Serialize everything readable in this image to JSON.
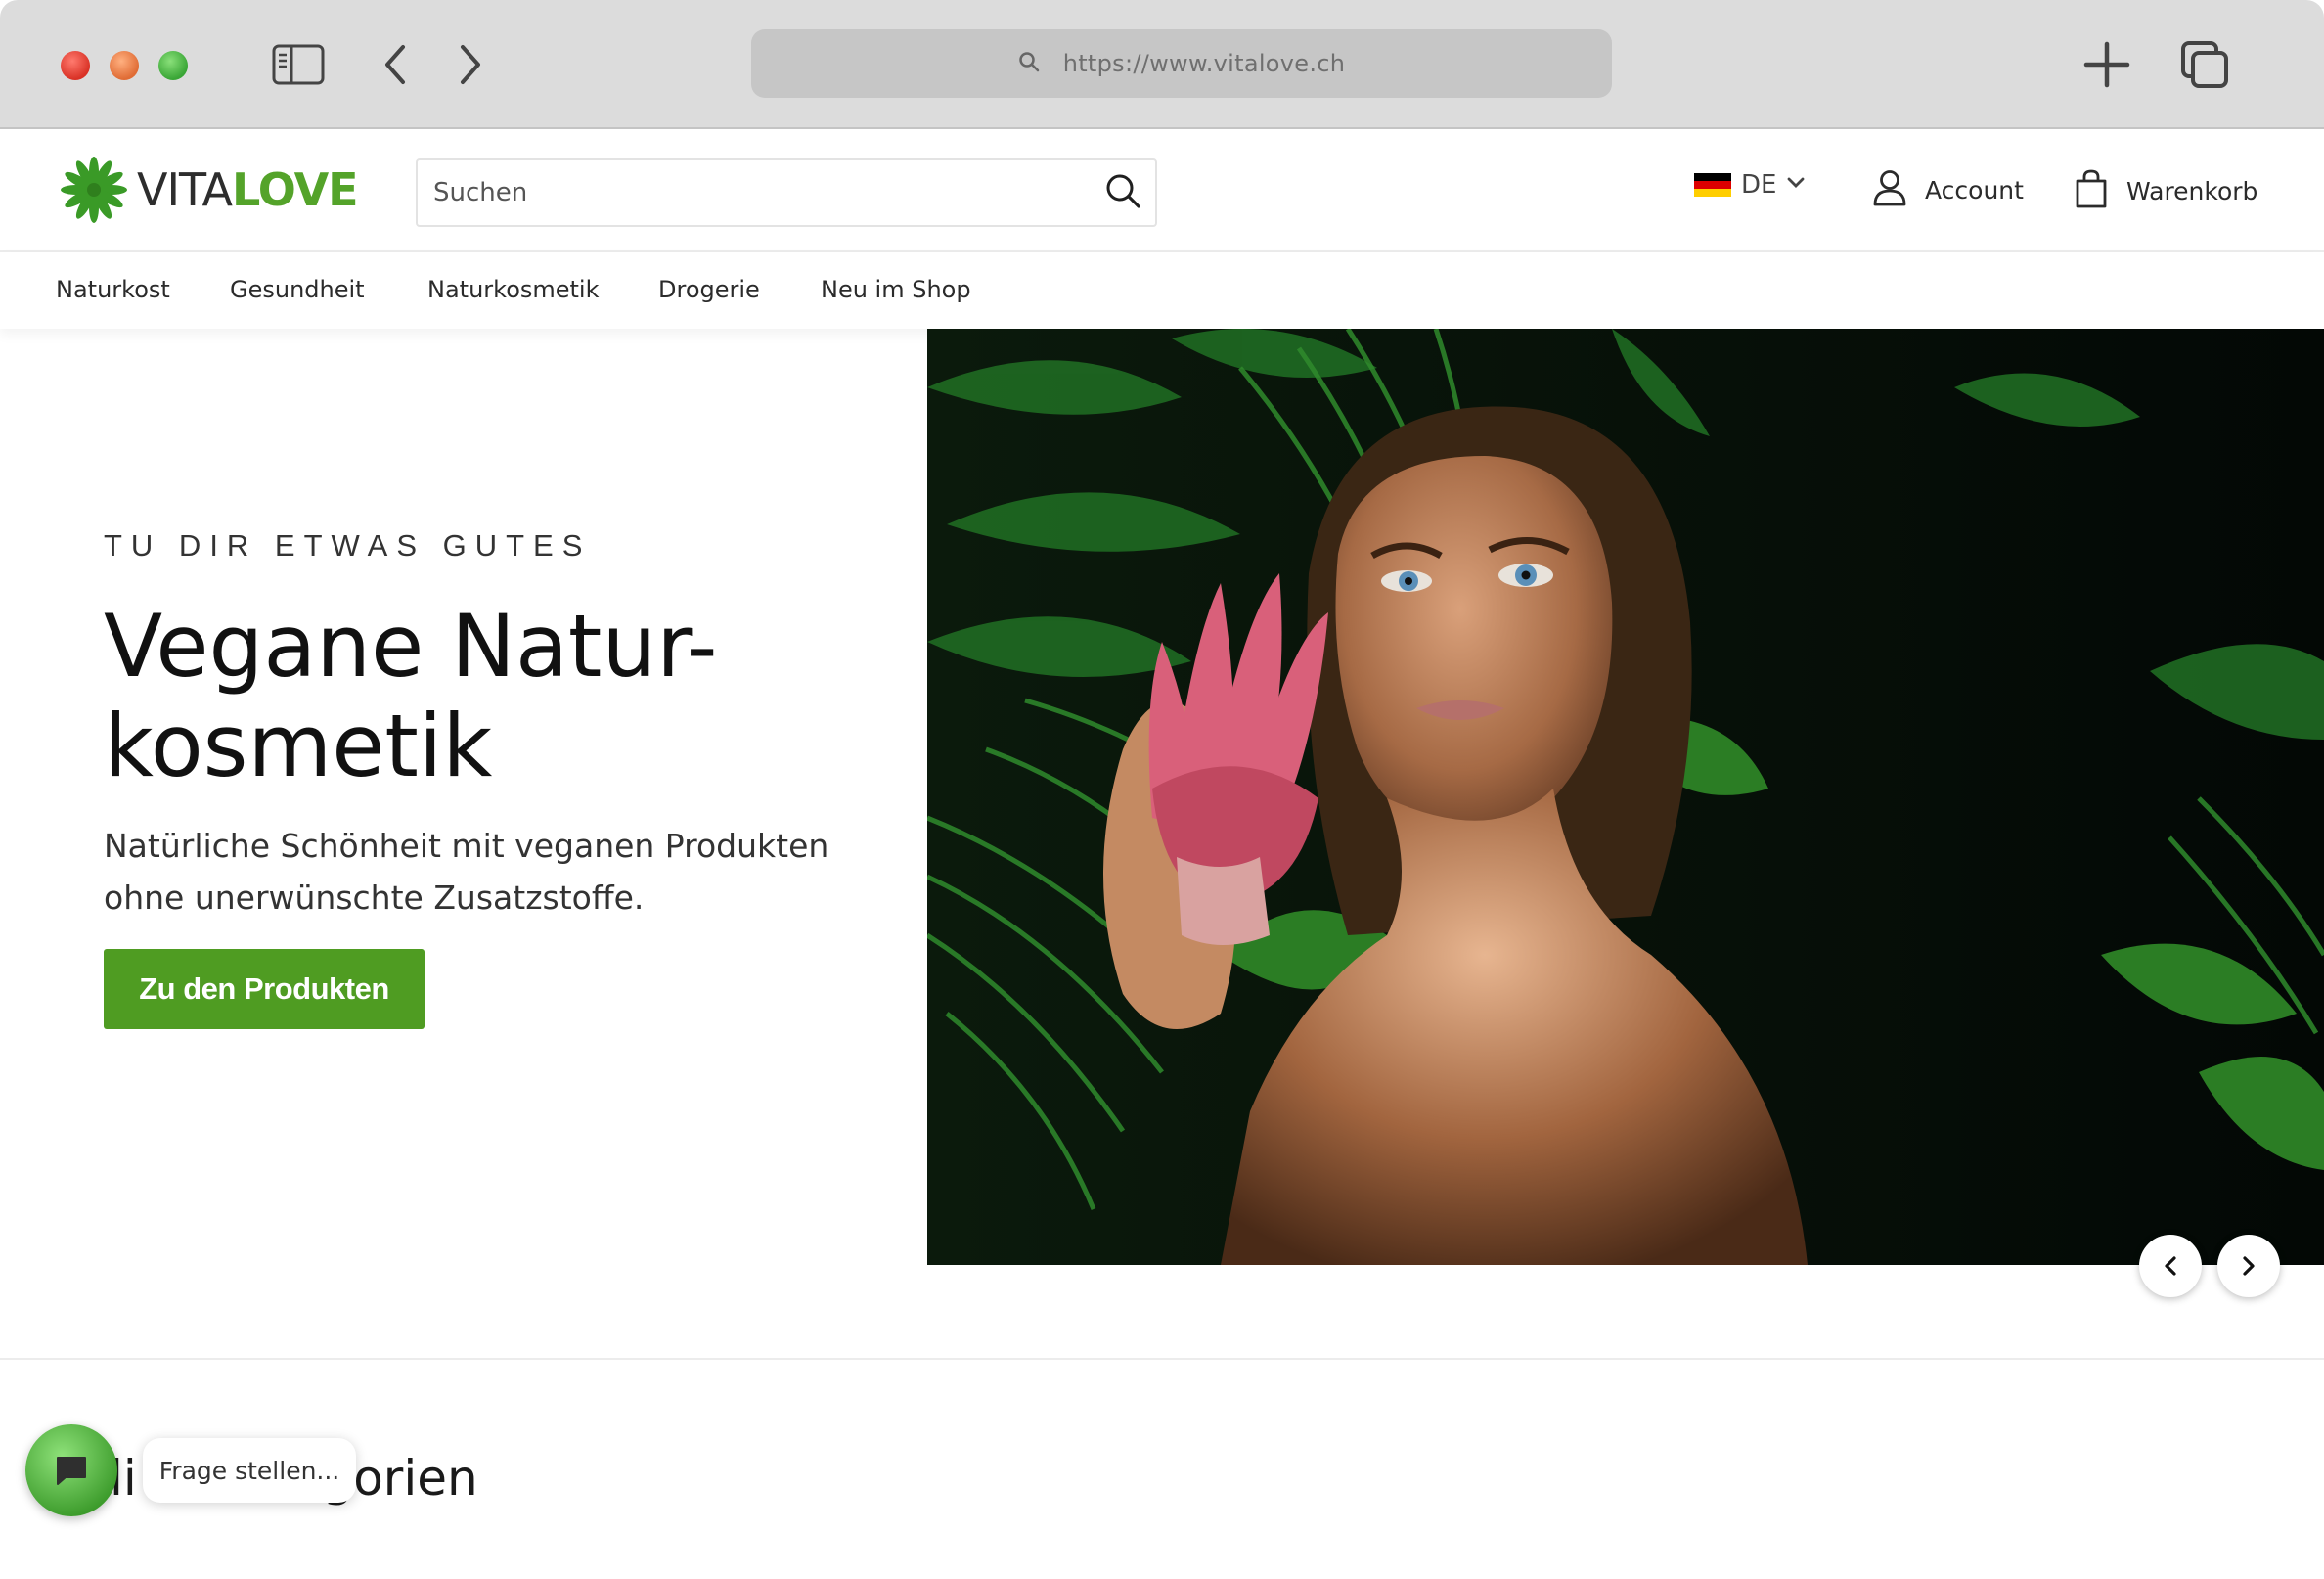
{
  "browser": {
    "url": "https://www.vitalove.ch"
  },
  "header": {
    "logo_vita": "VITA",
    "logo_love": "LOVE",
    "search_placeholder": "Suchen",
    "language": "DE",
    "account_label": "Account",
    "cart_label": "Warenkorb"
  },
  "nav": {
    "items": [
      "Naturkost",
      "Gesundheit",
      "Naturkosmetik",
      "Drogerie",
      "Neu im Shop"
    ]
  },
  "hero": {
    "eyebrow": "TU DIR ETWAS GUTES",
    "title_line1": "Vegane Natur-",
    "title_line2": "kosmetik",
    "subtitle_line1": "Natürliche Schönheit mit veganen Produkten",
    "subtitle_line2": "ohne unerwünschte Zusatzstoffe.",
    "cta_label": "Zu den Produkten"
  },
  "categories": {
    "title_visible": "li          egorien"
  },
  "chat": {
    "prompt": "Frage stellen..."
  },
  "colors": {
    "brand_green": "#4f9c22",
    "logo_green": "#54a32a"
  }
}
